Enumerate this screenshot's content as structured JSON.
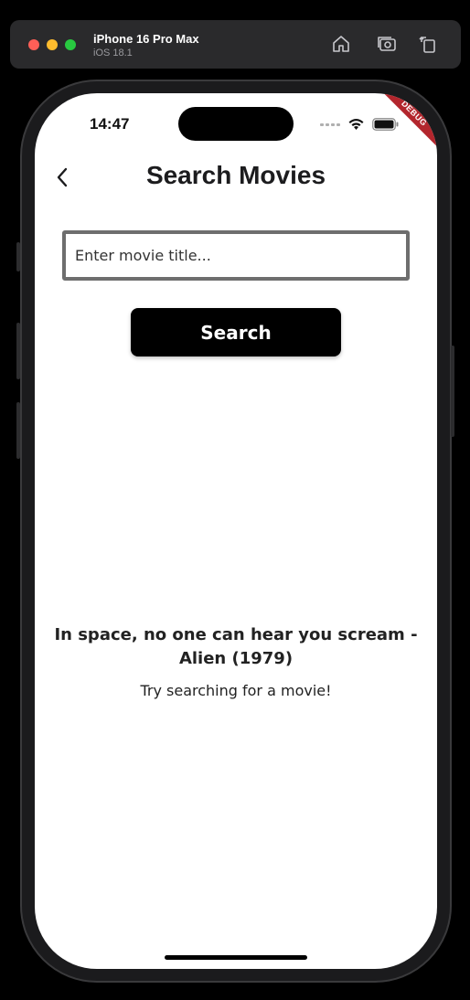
{
  "simulator": {
    "device_name": "iPhone 16 Pro Max",
    "os_version": "iOS 18.1",
    "icons": [
      "home-icon",
      "screenshot-icon",
      "rotate-icon"
    ]
  },
  "status_bar": {
    "time": "14:47",
    "icons": [
      "signal-icon",
      "wifi-icon",
      "battery-icon"
    ]
  },
  "debug_banner": "DEBUG",
  "header": {
    "title": "Search Movies",
    "back_icon": "chevron-left-icon"
  },
  "search": {
    "placeholder": "Enter movie title...",
    "value": "",
    "button_label": "Search"
  },
  "empty_state": {
    "quote": "In space, no one can hear you scream - Alien (1979)",
    "hint": "Try searching for a movie!"
  },
  "colors": {
    "button_bg": "#000000",
    "input_border": "#6e6e6e",
    "debug_banner": "#b3262d"
  }
}
